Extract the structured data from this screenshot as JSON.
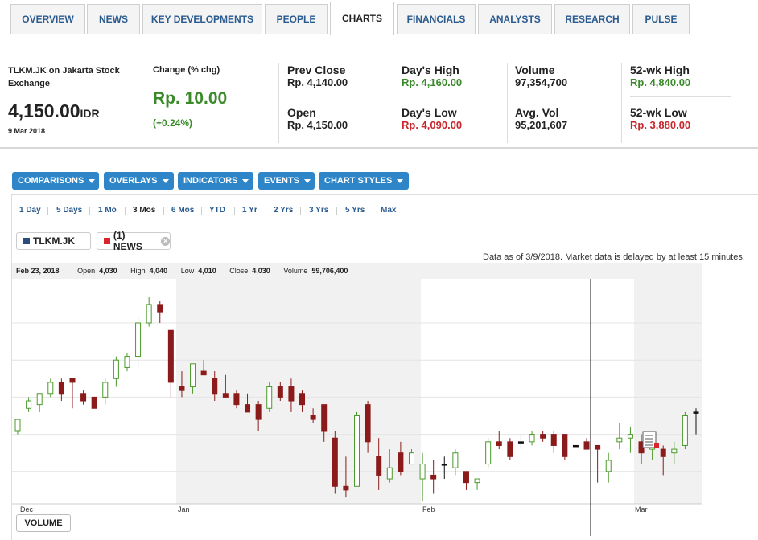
{
  "tabs": [
    "OVERVIEW",
    "NEWS",
    "KEY DEVELOPMENTS",
    "PEOPLE",
    "CHARTS",
    "FINANCIALS",
    "ANALYSTS",
    "RESEARCH",
    "PULSE"
  ],
  "quote": {
    "exchange": "TLKM.JK on Jakarta Stock Exchange",
    "price": "4,150.00",
    "currency": "IDR",
    "date": "9 Mar 2018",
    "change_label": "Change (% chg)",
    "change": "Rp. 10.00",
    "change_pct": "(+0.24%)",
    "stats": [
      {
        "label": "Prev Close",
        "value": "Rp. 4,140.00",
        "color": "#111111"
      },
      {
        "label": "Open",
        "value": "Rp. 4,150.00",
        "color": "#111111"
      },
      {
        "label": "Day's High",
        "value": "Rp. 4,160.00",
        "color": "#3a8a2a"
      },
      {
        "label": "Day's Low",
        "value": "Rp. 4,090.00",
        "color": "#c8262c"
      },
      {
        "label": "Volume",
        "value": "97,354,700",
        "color": "#111111"
      },
      {
        "label": "Avg. Vol",
        "value": "95,201,607",
        "color": "#111111"
      },
      {
        "label": "52-wk High",
        "value": "Rp. 4,840.00",
        "color": "#3a8a2a"
      },
      {
        "label": "52-wk Low",
        "value": "Rp. 3,880.00",
        "color": "#c8262c"
      }
    ]
  },
  "toolbar": [
    "COMPARISONS",
    "OVERLAYS",
    "INDICATORS",
    "EVENTS",
    "CHART STYLES"
  ],
  "ranges": [
    "1 Day",
    "5 Days",
    "1 Mo",
    "3 Mos",
    "6 Mos",
    "YTD",
    "1 Yr",
    "2 Yrs",
    "3 Yrs",
    "5 Yrs",
    "Max"
  ],
  "active_range": "3 Mos",
  "legend": {
    "ticker": "TLKM.JK",
    "news": "(1) NEWS",
    "ticker_color": "#2b4c7e",
    "news_color": "#d9262c"
  },
  "disclaimer": "Data as of 3/9/2018. Market data is delayed by at least 15 minutes.",
  "hover": {
    "date": "Feb 23, 2018",
    "open_label": "Open",
    "open": "4,030",
    "high_label": "High",
    "high": "4,040",
    "low_label": "Low",
    "low": "4,010",
    "close_label": "Close",
    "close": "4,030",
    "volume_label": "Volume",
    "volume": "59,706,400"
  },
  "volume_button": "VOLUME",
  "chart_data": {
    "type": "candlestick",
    "y_ticks": [
      "4,400",
      "4,300",
      "4,200",
      "4,100",
      "4,000"
    ],
    "y_tick_values": [
      4400,
      4300,
      4200,
      4100,
      4000
    ],
    "x_labels": [
      "Dec",
      "Jan",
      "Feb",
      "Mar"
    ],
    "colors": {
      "up": "#4a9a2a",
      "down": "#8b1a1a",
      "doji": "#111111"
    },
    "candles": [
      {
        "o": 4110,
        "h": 4140,
        "l": 4100,
        "c": 4140
      },
      {
        "o": 4170,
        "h": 4200,
        "l": 4160,
        "c": 4190
      },
      {
        "o": 4180,
        "h": 4210,
        "l": 4160,
        "c": 4210
      },
      {
        "o": 4210,
        "h": 4250,
        "l": 4200,
        "c": 4240
      },
      {
        "o": 4240,
        "h": 4250,
        "l": 4190,
        "c": 4210
      },
      {
        "o": 4250,
        "h": 4250,
        "l": 4170,
        "c": 4240
      },
      {
        "o": 4210,
        "h": 4220,
        "l": 4180,
        "c": 4190
      },
      {
        "o": 4200,
        "h": 4200,
        "l": 4170,
        "c": 4170
      },
      {
        "o": 4200,
        "h": 4250,
        "l": 4180,
        "c": 4240
      },
      {
        "o": 4250,
        "h": 4310,
        "l": 4230,
        "c": 4300
      },
      {
        "o": 4280,
        "h": 4320,
        "l": 4270,
        "c": 4310
      },
      {
        "o": 4310,
        "h": 4420,
        "l": 4280,
        "c": 4400
      },
      {
        "o": 4400,
        "h": 4470,
        "l": 4390,
        "c": 4450
      },
      {
        "o": 4450,
        "h": 4460,
        "l": 4400,
        "c": 4430
      },
      {
        "o": 4380,
        "h": 4380,
        "l": 4200,
        "c": 4240
      },
      {
        "o": 4230,
        "h": 4270,
        "l": 4200,
        "c": 4220
      },
      {
        "o": 4230,
        "h": 4290,
        "l": 4210,
        "c": 4290
      },
      {
        "o": 4270,
        "h": 4300,
        "l": 4260,
        "c": 4260
      },
      {
        "o": 4250,
        "h": 4270,
        "l": 4190,
        "c": 4210
      },
      {
        "o": 4210,
        "h": 4260,
        "l": 4200,
        "c": 4200
      },
      {
        "o": 4210,
        "h": 4220,
        "l": 4170,
        "c": 4180
      },
      {
        "o": 4180,
        "h": 4210,
        "l": 4160,
        "c": 4160
      },
      {
        "o": 4180,
        "h": 4190,
        "l": 4110,
        "c": 4140
      },
      {
        "o": 4170,
        "h": 4240,
        "l": 4160,
        "c": 4230
      },
      {
        "o": 4230,
        "h": 4240,
        "l": 4190,
        "c": 4200
      },
      {
        "o": 4230,
        "h": 4250,
        "l": 4160,
        "c": 4190
      },
      {
        "o": 4210,
        "h": 4220,
        "l": 4160,
        "c": 4180
      },
      {
        "o": 4150,
        "h": 4170,
        "l": 4130,
        "c": 4140
      },
      {
        "o": 4180,
        "h": 4180,
        "l": 4080,
        "c": 4110
      },
      {
        "o": 4090,
        "h": 4110,
        "l": 3940,
        "c": 3960
      },
      {
        "o": 3960,
        "h": 4040,
        "l": 3930,
        "c": 3950
      },
      {
        "o": 3960,
        "h": 4160,
        "l": 3960,
        "c": 4150
      },
      {
        "o": 4180,
        "h": 4190,
        "l": 4050,
        "c": 4080
      },
      {
        "o": 4040,
        "h": 4090,
        "l": 3950,
        "c": 3990
      },
      {
        "o": 3980,
        "h": 4060,
        "l": 3970,
        "c": 4010
      },
      {
        "o": 4050,
        "h": 4080,
        "l": 3990,
        "c": 4000
      },
      {
        "o": 4020,
        "h": 4060,
        "l": 4020,
        "c": 4050
      },
      {
        "o": 3980,
        "h": 4050,
        "l": 3920,
        "c": 4020
      },
      {
        "o": 3990,
        "h": 4030,
        "l": 3940,
        "c": 3980
      },
      {
        "o": 4020,
        "h": 4040,
        "l": 3980,
        "c": 4020
      },
      {
        "o": 4010,
        "h": 4060,
        "l": 3990,
        "c": 4050
      },
      {
        "o": 4000,
        "h": 4000,
        "l": 3950,
        "c": 3970
      },
      {
        "o": 3970,
        "h": 3980,
        "l": 3950,
        "c": 3980
      },
      {
        "o": 4020,
        "h": 4090,
        "l": 4010,
        "c": 4080
      },
      {
        "o": 4080,
        "h": 4110,
        "l": 4060,
        "c": 4070
      },
      {
        "o": 4080,
        "h": 4090,
        "l": 4030,
        "c": 4040
      },
      {
        "o": 4080,
        "h": 4100,
        "l": 4060,
        "c": 4080
      },
      {
        "o": 4080,
        "h": 4110,
        "l": 4070,
        "c": 4100
      },
      {
        "o": 4100,
        "h": 4110,
        "l": 4080,
        "c": 4090
      },
      {
        "o": 4100,
        "h": 4110,
        "l": 4050,
        "c": 4070
      },
      {
        "o": 4100,
        "h": 4100,
        "l": 4030,
        "c": 4040
      },
      {
        "o": 4070,
        "h": 4070,
        "l": 4070,
        "c": 4070
      },
      {
        "o": 4080,
        "h": 4090,
        "l": 4060,
        "c": 4060
      },
      {
        "o": 4070,
        "h": 4070,
        "l": 3970,
        "c": 4060
      },
      {
        "o": 4000,
        "h": 4050,
        "l": 3970,
        "c": 4030
      },
      {
        "o": 4080,
        "h": 4130,
        "l": 4060,
        "c": 4090
      },
      {
        "o": 4090,
        "h": 4120,
        "l": 4050,
        "c": 4100
      },
      {
        "o": 4080,
        "h": 4100,
        "l": 4020,
        "c": 4050
      },
      {
        "o": 4060,
        "h": 4080,
        "l": 4030,
        "c": 4080
      },
      {
        "o": 4060,
        "h": 4070,
        "l": 3990,
        "c": 4040
      },
      {
        "o": 4050,
        "h": 4080,
        "l": 4020,
        "c": 4060
      },
      {
        "o": 4070,
        "h": 4160,
        "l": 4060,
        "c": 4150
      },
      {
        "o": 4160,
        "h": 4170,
        "l": 4100,
        "c": 4160
      }
    ]
  }
}
